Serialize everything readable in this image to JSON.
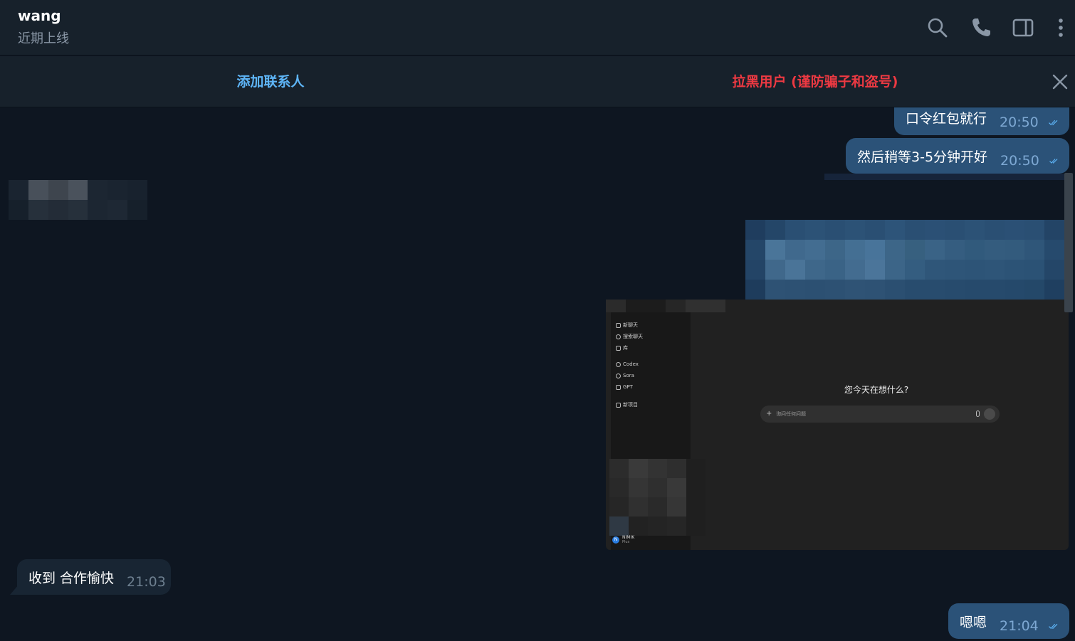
{
  "header": {
    "name": "wang",
    "status": "近期上线"
  },
  "action_bar": {
    "add_contact": "添加联系人",
    "block_user": "拉黑用户 (谨防骗子和盗号)"
  },
  "messages": [
    {
      "direction": "out",
      "text": "口令红包就行",
      "time": "20:50",
      "read": true
    },
    {
      "direction": "out",
      "text": "然后稍等3-5分钟开好",
      "time": "20:50",
      "read": true
    },
    {
      "direction": "in",
      "text": "收到 合作愉快",
      "time": "21:03"
    },
    {
      "direction": "out",
      "text": "嗯嗯",
      "time": "21:04",
      "read": true
    }
  ],
  "screenshot": {
    "sidebar_items": [
      "新聊天",
      "搜索聊天",
      "库",
      "Codex",
      "Sora",
      "GPT",
      "新项目"
    ],
    "prompt_title": "您今天在想什么?",
    "input_placeholder": "询问任何问题",
    "user_initial": "N",
    "user_name": "NIMIK",
    "user_plan": "Plus"
  },
  "colors": {
    "background": "#0e1621",
    "header": "#17212b",
    "outgoing_bubble": "#2b5278",
    "incoming_bubble": "#182533",
    "link_blue": "#5eb5f7",
    "danger_red": "#ec3942",
    "read_check": "#5eb5f7"
  },
  "icons": [
    "search-icon",
    "phone-icon",
    "sidebar-toggle-icon",
    "more-vertical-icon",
    "close-icon",
    "double-check-icon"
  ]
}
